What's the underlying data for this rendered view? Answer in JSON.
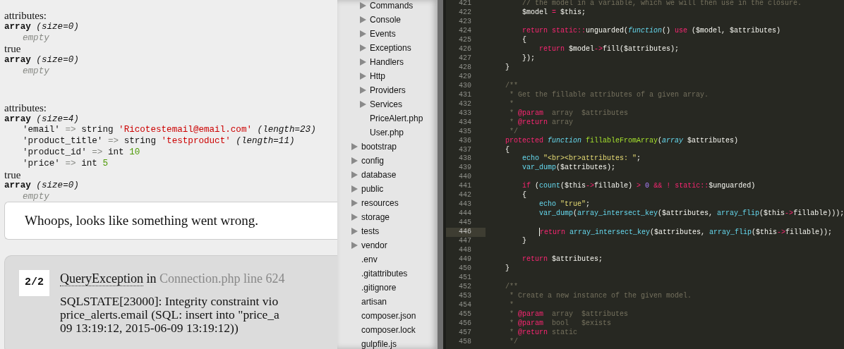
{
  "dump_output": [
    {
      "blocks": [
        {
          "kind": "label",
          "text": "attributes:"
        },
        {
          "kind": "array",
          "type": "array",
          "size": "(size=0)"
        },
        {
          "kind": "empty",
          "text": "empty"
        },
        {
          "kind": "plain",
          "text": "true"
        },
        {
          "kind": "array",
          "type": "array",
          "size": "(size=0)"
        },
        {
          "kind": "empty",
          "text": "empty"
        }
      ]
    },
    {
      "blocks": [
        {
          "kind": "label",
          "text": "attributes:"
        },
        {
          "kind": "array",
          "type": "array",
          "size": "(size=4)"
        },
        {
          "kind": "entry",
          "key": "'email'",
          "arrow": "=>",
          "type": "string",
          "value": "'Ricotestemail@email.com'",
          "color": "#cc0000",
          "extra": "(length=23)"
        },
        {
          "kind": "entry",
          "key": "'product_title'",
          "arrow": "=>",
          "type": "string",
          "value": "'testproduct'",
          "color": "#cc0000",
          "extra": "(length=11)"
        },
        {
          "kind": "entry",
          "key": "'product_id'",
          "arrow": "=>",
          "type": "int",
          "value": "10",
          "color": "#4e9a06"
        },
        {
          "kind": "entry",
          "key": "'price'",
          "arrow": "=>",
          "type": "int",
          "value": "5",
          "color": "#4e9a06"
        },
        {
          "kind": "plain",
          "text": "true"
        },
        {
          "kind": "array",
          "type": "array",
          "size": "(size=0)"
        },
        {
          "kind": "empty",
          "text": "empty"
        }
      ]
    }
  ],
  "error_page": {
    "headline": "Whoops, looks like something went wrong.",
    "exception": {
      "counter": "2/2",
      "class": "QueryException",
      "in": "in",
      "location": "Connection.php line 624",
      "message_lines": [
        "SQLSTATE[23000]: Integrity constraint vio",
        "price_alerts.email (SQL: insert into \"price_a",
        "09 13:19:12, 2015-06-09 13:19:12))"
      ]
    }
  },
  "file_tree": [
    {
      "children": [
        {
          "label": "Commands",
          "kind": "folder",
          "expanded": false
        },
        {
          "label": "Console",
          "kind": "folder",
          "expanded": false
        },
        {
          "label": "Events",
          "kind": "folder",
          "expanded": false
        },
        {
          "label": "Exceptions",
          "kind": "folder",
          "expanded": false
        },
        {
          "label": "Handlers",
          "kind": "folder",
          "expanded": false
        },
        {
          "label": "Http",
          "kind": "folder",
          "expanded": false
        },
        {
          "label": "Providers",
          "kind": "folder",
          "expanded": false
        },
        {
          "label": "Services",
          "kind": "folder",
          "expanded": false
        },
        {
          "label": "PriceAlert.php",
          "kind": "file"
        },
        {
          "label": "User.php",
          "kind": "file"
        }
      ]
    },
    {
      "label": "bootstrap",
      "kind": "folder",
      "expanded": false
    },
    {
      "label": "config",
      "kind": "folder",
      "expanded": false
    },
    {
      "label": "database",
      "kind": "folder",
      "expanded": false
    },
    {
      "label": "public",
      "kind": "folder",
      "expanded": false
    },
    {
      "label": "resources",
      "kind": "folder",
      "expanded": false
    },
    {
      "label": "storage",
      "kind": "folder",
      "expanded": false
    },
    {
      "label": "tests",
      "kind": "folder",
      "expanded": false
    },
    {
      "label": "vendor",
      "kind": "folder",
      "expanded": false
    },
    {
      "label": ".env",
      "kind": "file"
    },
    {
      "label": ".gitattributes",
      "kind": "file"
    },
    {
      "label": ".gitignore",
      "kind": "file"
    },
    {
      "label": "artisan",
      "kind": "file"
    },
    {
      "label": "composer.json",
      "kind": "file"
    },
    {
      "label": "composer.lock",
      "kind": "file"
    },
    {
      "label": "gulpfile.js",
      "kind": "file"
    }
  ],
  "editor": {
    "lines": [
      {
        "number": "421",
        "selected": false,
        "tokens": [
          {
            "text": "        // the model in a variable, which we will then use in the closure.",
            "kind": "comment"
          }
        ]
      },
      {
        "number": "422",
        "selected": false,
        "tokens": [
          {
            "text": "        $model ",
            "kind": "plain"
          },
          {
            "text": "=",
            "kind": "keyword"
          },
          {
            "text": " $this;",
            "kind": "plain"
          }
        ]
      },
      {
        "number": "423",
        "selected": false
      },
      {
        "number": "424",
        "selected": false,
        "tokens": [
          {
            "text": "        return",
            "kind": "keyword"
          },
          {
            "text": " static::",
            "kind": "keyword"
          },
          {
            "text": "unguarded(",
            "kind": "plain"
          },
          {
            "text": "function",
            "kind": "storage"
          },
          {
            "text": "() ",
            "kind": "plain"
          },
          {
            "text": "use",
            "kind": "keyword"
          },
          {
            "text": " ($model, $attributes)",
            "kind": "plain"
          }
        ]
      },
      {
        "number": "425",
        "selected": false,
        "tokens": [
          {
            "text": "        {",
            "kind": "plain"
          }
        ]
      },
      {
        "number": "426",
        "selected": false,
        "tokens": [
          {
            "text": "            return",
            "kind": "keyword"
          },
          {
            "text": " $model",
            "kind": "plain"
          },
          {
            "text": "->",
            "kind": "keyword"
          },
          {
            "text": "fill($attributes);",
            "kind": "plain"
          }
        ]
      },
      {
        "number": "427",
        "selected": false,
        "tokens": [
          {
            "text": "        });",
            "kind": "plain"
          }
        ]
      },
      {
        "number": "428",
        "selected": false,
        "tokens": [
          {
            "text": "    }",
            "kind": "plain"
          }
        ]
      },
      {
        "number": "429",
        "selected": false
      },
      {
        "number": "430",
        "selected": false,
        "tokens": [
          {
            "text": "    /**",
            "kind": "comment"
          }
        ]
      },
      {
        "number": "431",
        "selected": false,
        "tokens": [
          {
            "text": "     * Get the fillable attributes of a given array.",
            "kind": "comment"
          }
        ]
      },
      {
        "number": "432",
        "selected": false,
        "tokens": [
          {
            "text": "     *",
            "kind": "comment"
          }
        ]
      },
      {
        "number": "433",
        "selected": false,
        "tokens": [
          {
            "text": "     * ",
            "kind": "comment"
          },
          {
            "text": "@param",
            "kind": "keyword"
          },
          {
            "text": "  array  $attributes",
            "kind": "comment"
          }
        ]
      },
      {
        "number": "434",
        "selected": false,
        "tokens": [
          {
            "text": "     * ",
            "kind": "comment"
          },
          {
            "text": "@return",
            "kind": "keyword"
          },
          {
            "text": " array",
            "kind": "comment"
          }
        ]
      },
      {
        "number": "435",
        "selected": false,
        "tokens": [
          {
            "text": "     */",
            "kind": "comment"
          }
        ]
      },
      {
        "number": "436",
        "selected": false,
        "tokens": [
          {
            "text": "    protected ",
            "kind": "keyword"
          },
          {
            "text": "function ",
            "kind": "storage"
          },
          {
            "text": "fillableFromArray",
            "kind": "function"
          },
          {
            "text": "(",
            "kind": "plain"
          },
          {
            "text": "array",
            "kind": "storage"
          },
          {
            "text": " $attributes)",
            "kind": "plain"
          }
        ]
      },
      {
        "number": "437",
        "selected": false,
        "tokens": [
          {
            "text": "    {",
            "kind": "plain"
          }
        ]
      },
      {
        "number": "438",
        "selected": false,
        "tokens": [
          {
            "text": "        echo ",
            "kind": "support"
          },
          {
            "text": "\"<br><br>attributes: \"",
            "kind": "string"
          },
          {
            "text": ";",
            "kind": "plain"
          }
        ]
      },
      {
        "number": "439",
        "selected": false,
        "tokens": [
          {
            "text": "        var_dump",
            "kind": "support"
          },
          {
            "text": "($attributes);",
            "kind": "plain"
          }
        ]
      },
      {
        "number": "440",
        "selected": false
      },
      {
        "number": "441",
        "selected": false,
        "tokens": [
          {
            "text": "        if",
            "kind": "keyword"
          },
          {
            "text": " (",
            "kind": "plain"
          },
          {
            "text": "count",
            "kind": "support"
          },
          {
            "text": "($this",
            "kind": "plain"
          },
          {
            "text": "->",
            "kind": "keyword"
          },
          {
            "text": "fillable) ",
            "kind": "plain"
          },
          {
            "text": "> ",
            "kind": "keyword"
          },
          {
            "text": "0",
            "kind": "number"
          },
          {
            "text": " && ! static::",
            "kind": "keyword"
          },
          {
            "text": "$unguarded)",
            "kind": "plain"
          }
        ]
      },
      {
        "number": "442",
        "selected": false,
        "tokens": [
          {
            "text": "        {",
            "kind": "plain"
          }
        ]
      },
      {
        "number": "443",
        "selected": false,
        "tokens": [
          {
            "text": "            echo ",
            "kind": "support"
          },
          {
            "text": "\"true\"",
            "kind": "string"
          },
          {
            "text": ";",
            "kind": "plain"
          }
        ]
      },
      {
        "number": "444",
        "selected": false,
        "tokens": [
          {
            "text": "            var_dump",
            "kind": "support"
          },
          {
            "text": "(",
            "kind": "plain"
          },
          {
            "text": "array_intersect_key",
            "kind": "support"
          },
          {
            "text": "($attributes, ",
            "kind": "plain"
          },
          {
            "text": "array_flip",
            "kind": "support"
          },
          {
            "text": "($this",
            "kind": "plain"
          },
          {
            "text": "->",
            "kind": "keyword"
          },
          {
            "text": "fillable)));",
            "kind": "plain"
          }
        ]
      },
      {
        "number": "445",
        "selected": false
      },
      {
        "number": "446",
        "selected": true,
        "tokens": [
          {
            "text": "            return ",
            "kind": "keyword"
          },
          {
            "text": "array_intersect_key",
            "kind": "support"
          },
          {
            "text": "($attributes, ",
            "kind": "plain"
          },
          {
            "text": "array_flip",
            "kind": "support"
          },
          {
            "text": "($this",
            "kind": "plain"
          },
          {
            "text": "->",
            "kind": "keyword"
          },
          {
            "text": "fillable));",
            "kind": "plain"
          }
        ]
      },
      {
        "number": "447",
        "selected": false,
        "tokens": [
          {
            "text": "        }",
            "kind": "plain"
          }
        ]
      },
      {
        "number": "448",
        "selected": false
      },
      {
        "number": "449",
        "selected": false,
        "tokens": [
          {
            "text": "        return",
            "kind": "keyword"
          },
          {
            "text": " $attributes;",
            "kind": "plain"
          }
        ]
      },
      {
        "number": "450",
        "selected": false,
        "tokens": [
          {
            "text": "    }",
            "kind": "plain"
          }
        ]
      },
      {
        "number": "451",
        "selected": false
      },
      {
        "number": "452",
        "selected": false,
        "tokens": [
          {
            "text": "    /**",
            "kind": "comment"
          }
        ]
      },
      {
        "number": "453",
        "selected": false,
        "tokens": [
          {
            "text": "     * Create a new instance of the given model.",
            "kind": "comment"
          }
        ]
      },
      {
        "number": "454",
        "selected": false,
        "tokens": [
          {
            "text": "     *",
            "kind": "comment"
          }
        ]
      },
      {
        "number": "455",
        "selected": false,
        "tokens": [
          {
            "text": "     * ",
            "kind": "comment"
          },
          {
            "text": "@param",
            "kind": "keyword"
          },
          {
            "text": "  array  $attributes",
            "kind": "comment"
          }
        ]
      },
      {
        "number": "456",
        "selected": false,
        "tokens": [
          {
            "text": "     * ",
            "kind": "comment"
          },
          {
            "text": "@param",
            "kind": "keyword"
          },
          {
            "text": "  bool   $exists",
            "kind": "comment"
          }
        ]
      },
      {
        "number": "457",
        "selected": false,
        "tokens": [
          {
            "text": "     * ",
            "kind": "comment"
          },
          {
            "text": "@return",
            "kind": "keyword"
          },
          {
            "text": " static",
            "kind": "comment"
          }
        ]
      },
      {
        "number": "458",
        "selected": false,
        "tokens": [
          {
            "text": "     */",
            "kind": "comment"
          }
        ]
      }
    ]
  }
}
